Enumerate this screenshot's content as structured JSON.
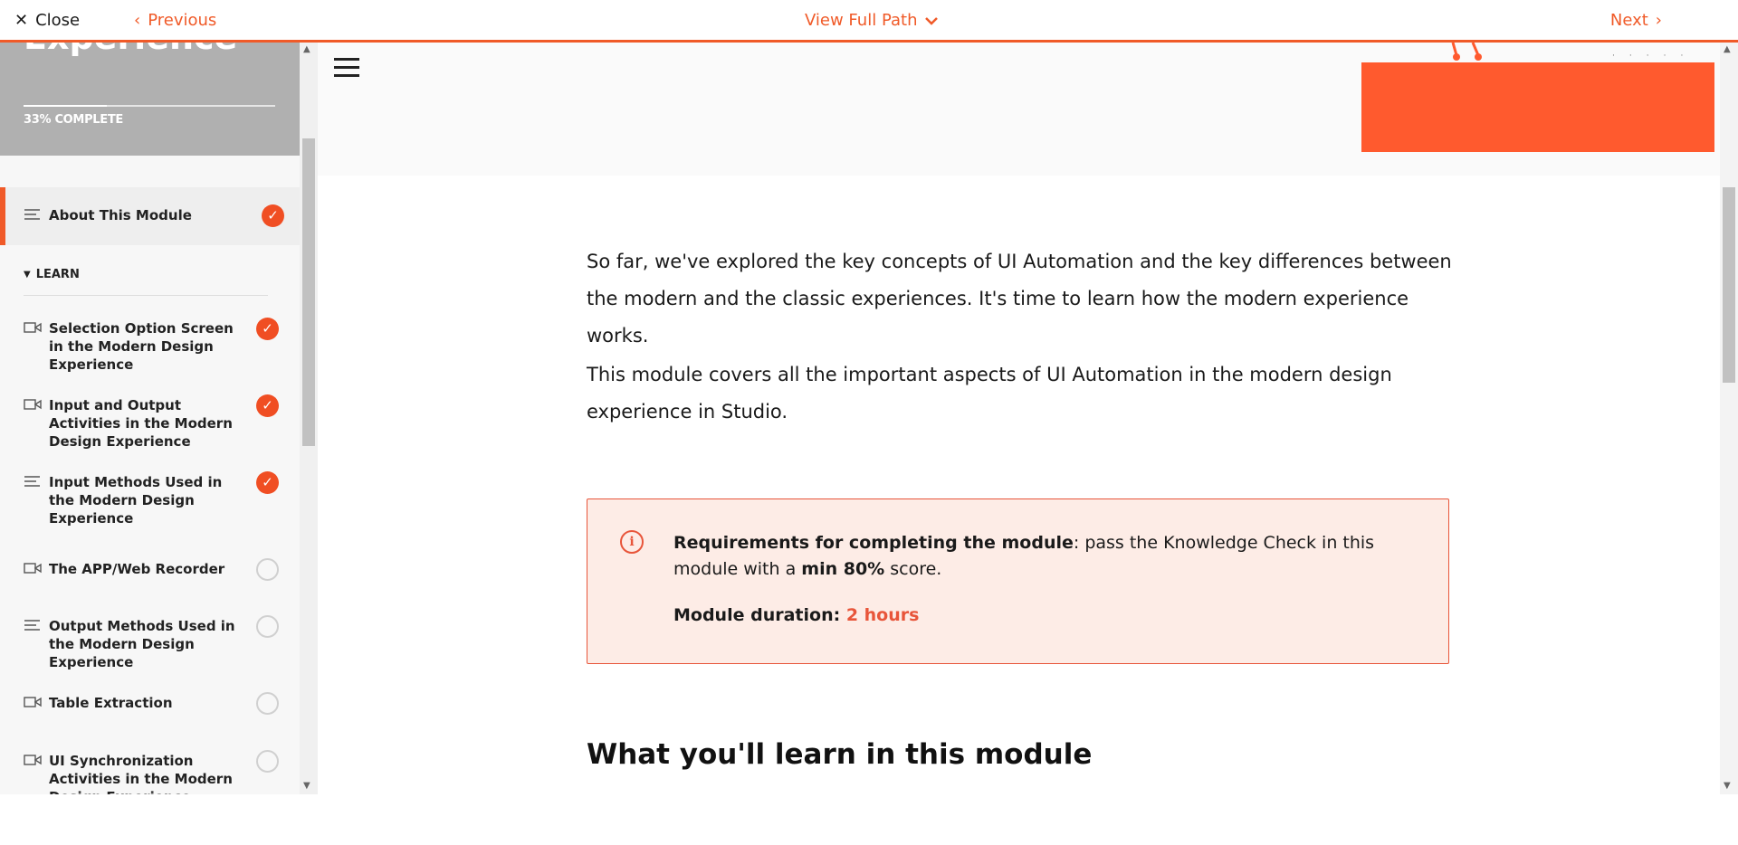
{
  "topbar": {
    "close_label": "Close",
    "previous_label": "Previous",
    "view_path_label": "View Full Path",
    "next_label": "Next"
  },
  "sidebar": {
    "course_title": "Experience",
    "progress_percent": 33,
    "progress_label": "33% COMPLETE",
    "section_label": "LEARN",
    "items": [
      {
        "label": "About This Module",
        "type": "text-icon",
        "status": "completed"
      },
      {
        "label": "Selection Option Screen in the Modern Design Experience",
        "type": "video-icon",
        "status": "completed"
      },
      {
        "label": "Input and Output Activities in the Modern Design Experience",
        "type": "video-icon",
        "status": "completed"
      },
      {
        "label": "Input Methods Used in the Modern Design Experience",
        "type": "text-icon",
        "status": "completed"
      },
      {
        "label": "The APP/Web Recorder",
        "type": "video-icon",
        "status": "not-started"
      },
      {
        "label": "Output Methods Used in the Modern Design Experience",
        "type": "text-icon",
        "status": "not-started"
      },
      {
        "label": "Table Extraction",
        "type": "video-icon",
        "status": "not-started"
      },
      {
        "label": "UI Synchronization Activities in the Modern Design Experience",
        "type": "video-icon",
        "status": "not-started"
      }
    ]
  },
  "main": {
    "paragraph_1": "So far, we've explored the key concepts of UI Automation and the key differences between the modern and the classic experiences. It's time to learn how the modern experience works.",
    "paragraph_2": "This module covers all the important aspects of UI Automation in the modern design experience in Studio.",
    "callout": {
      "req_bold": "Requirements for completing the module",
      "req_text": ": pass the Knowledge Check in this module with a ",
      "req_min": "min 80%",
      "req_end": " score.",
      "duration_label": "Module duration: ",
      "duration_value": "2 hours"
    },
    "heading": "What you'll learn in this module"
  },
  "colors": {
    "accent": "#f05a28",
    "callout_bg": "#fdece6",
    "hero_block": "#ff5a2e",
    "sidebar_header": "#b0b0b0"
  }
}
